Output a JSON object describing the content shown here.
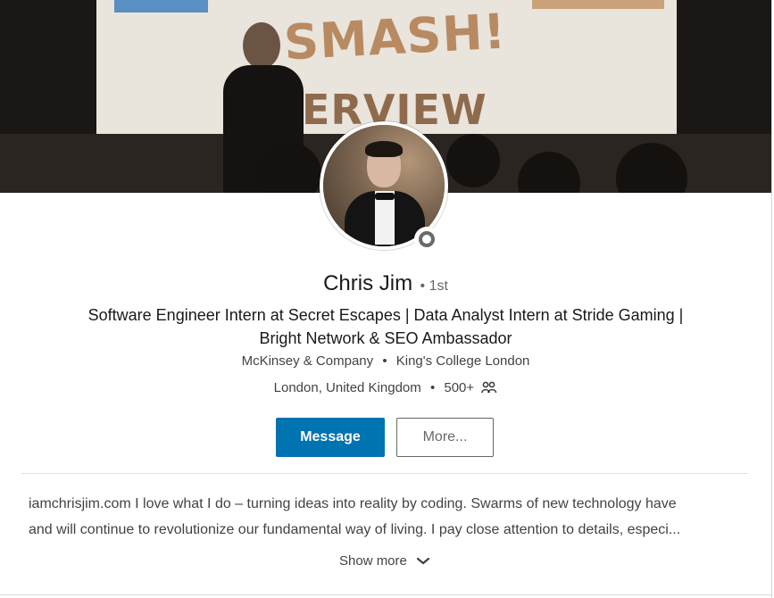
{
  "profile": {
    "name": "Chris Jim",
    "degree": "• 1st",
    "headline_line1": "Software Engineer Intern at Secret Escapes | Data Analyst Intern at Stride Gaming |",
    "headline_line2": "Bright Network & SEO Ambassador",
    "company": "McKinsey & Company",
    "school": "King's College London",
    "location": "London, United Kingdom",
    "connections": "500+",
    "bullet": "•"
  },
  "banner": {
    "word1": "SMASH!",
    "word2": "INTERVIEW"
  },
  "actions": {
    "message_label": "Message",
    "more_label": "More..."
  },
  "about": {
    "line1": "iamchrisjim.com I love what I do – turning ideas into reality by coding. Swarms of new technology have",
    "line2": "and will continue to revolutionize our fundamental way of living. I pay close attention to details, especi...",
    "show_more_label": "Show more"
  },
  "icons": {
    "connections": "people-icon",
    "show_more": "chevron-down-icon",
    "status": "status-ring-icon"
  },
  "colors": {
    "primary": "#0073b1",
    "text": "#000000",
    "muted": "#666666"
  }
}
